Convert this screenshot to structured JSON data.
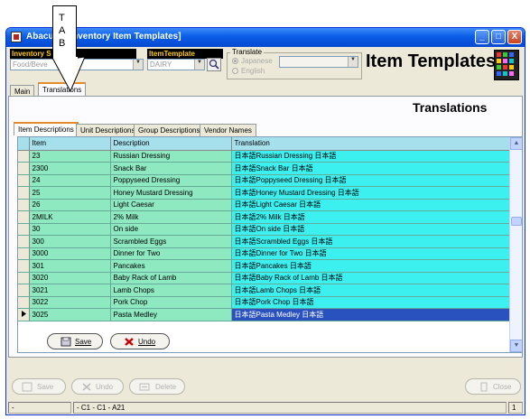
{
  "window": {
    "title": "Abacus - [Inventory Item Templates]",
    "buttons": {
      "minimize": "_",
      "maximize": "□",
      "close": "X"
    }
  },
  "filters": {
    "inventory_label": "Inventory S",
    "inventory_value": "Food/Beve",
    "itemtemplate_label": "ItemTemplate",
    "itemtemplate_value": "DAIRY",
    "translate_label": "Translate",
    "translate_options": [
      "Japanese",
      "English"
    ],
    "translate_selected": "Japanese"
  },
  "header": {
    "title": "Item Templates",
    "section_title": "Translations"
  },
  "tabs": {
    "main": [
      "Main",
      "Translations"
    ],
    "active_main": "Translations",
    "sub": [
      "Item Descriptions",
      "Unit Descriptions",
      "Group Descriptions",
      "Vendor Names"
    ],
    "active_sub": "Item Descriptions"
  },
  "grid": {
    "columns": [
      "Item",
      "Description",
      "Translation"
    ],
    "rows": [
      {
        "item": "23",
        "description": "Russian Dressing",
        "translation": "日本語Russian Dressing 日本語"
      },
      {
        "item": "2300",
        "description": "Snack Bar",
        "translation": "日本語Snack Bar 日本語"
      },
      {
        "item": "24",
        "description": "Poppyseed Dressing",
        "translation": "日本語Poppyseed Dressing 日本語"
      },
      {
        "item": "25",
        "description": "Honey Mustard Dressing",
        "translation": "日本語Honey Mustard Dressing 日本語"
      },
      {
        "item": "26",
        "description": "Light Caesar",
        "translation": "日本語Light Caesar 日本語"
      },
      {
        "item": "2MILK",
        "description": "2% Milk",
        "translation": "日本語2% Milk 日本語"
      },
      {
        "item": "30",
        "description": "On side",
        "translation": "日本語On side 日本語"
      },
      {
        "item": "300",
        "description": "Scrambled Eggs",
        "translation": "日本語Scrambled Eggs 日本語"
      },
      {
        "item": "3000",
        "description": "Dinner for Two",
        "translation": "日本語Dinner for Two 日本語"
      },
      {
        "item": "301",
        "description": "Pancakes",
        "translation": "日本語Pancakes 日本語"
      },
      {
        "item": "3020",
        "description": "Baby Rack of Lamb",
        "translation": "日本語Baby Rack of Lamb 日本語"
      },
      {
        "item": "3021",
        "description": "Lamb Chops",
        "translation": "日本語Lamb Chops 日本語"
      },
      {
        "item": "3022",
        "description": "Pork Chop",
        "translation": "日本語Pork Chop 日本語"
      },
      {
        "item": "3025",
        "description": "Pasta Medley",
        "translation": "日本語Pasta Medley 日本語"
      }
    ],
    "selected_row": "3025"
  },
  "grid_buttons": {
    "save": "Save",
    "undo": "Undo"
  },
  "bottom_buttons": {
    "save": "Save",
    "undo": "Undo",
    "delete": "Delete",
    "close": "Close"
  },
  "status": {
    "left": "-",
    "position": "- C1 - C1 - A21",
    "page": "1"
  },
  "callout": {
    "letters": "T A B"
  }
}
